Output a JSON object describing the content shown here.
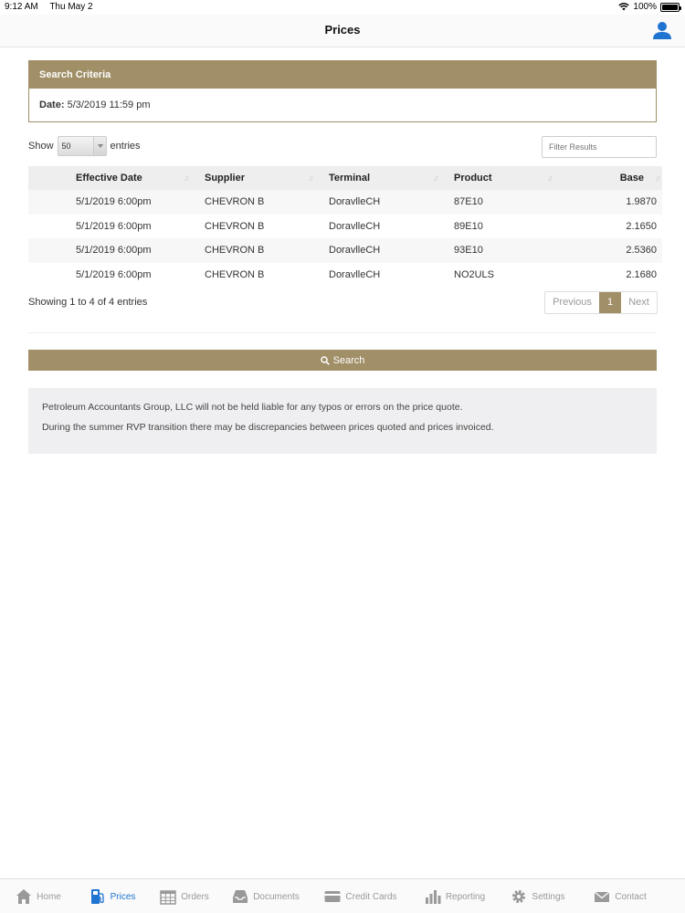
{
  "status": {
    "time": "9:12 AM",
    "date": "Thu May 2",
    "battery": "100%"
  },
  "nav": {
    "title": "Prices"
  },
  "criteria": {
    "header": "Search Criteria",
    "date_label": "Date:",
    "date_value": "5/3/2019 11:59 pm"
  },
  "controls": {
    "show_label": "Show",
    "entries_value": "50",
    "entries_label": "entries",
    "filter_placeholder": "Filter Results"
  },
  "table": {
    "headers": [
      "Effective Date",
      "Supplier",
      "Terminal",
      "Product",
      "Base"
    ],
    "rows": [
      [
        "5/1/2019 6:00pm",
        "CHEVRON B",
        "DoravlleCH",
        "87E10",
        "1.9870"
      ],
      [
        "5/1/2019 6:00pm",
        "CHEVRON B",
        "DoravlleCH",
        "89E10",
        "2.1650"
      ],
      [
        "5/1/2019 6:00pm",
        "CHEVRON B",
        "DoravlleCH",
        "93E10",
        "2.5360"
      ],
      [
        "5/1/2019 6:00pm",
        "CHEVRON B",
        "DoravlleCH",
        "NO2ULS",
        "2.1680"
      ]
    ]
  },
  "info": "Showing 1 to 4 of 4 entries",
  "pager": {
    "previous": "Previous",
    "page": "1",
    "next": "Next"
  },
  "search_button": "Search",
  "disclaimer": [
    "Petroleum Accountants Group, LLC will not be held liable for any typos or errors on the price quote.",
    "During the summer RVP transition there may be discrepancies between prices quoted and prices invoiced."
  ],
  "tabs": [
    {
      "label": "Home",
      "icon": "home-icon"
    },
    {
      "label": "Prices",
      "icon": "fuel-pump-icon"
    },
    {
      "label": "Orders",
      "icon": "calendar-icon"
    },
    {
      "label": "Documents",
      "icon": "inbox-icon"
    },
    {
      "label": "Credit Cards",
      "icon": "credit-card-icon"
    },
    {
      "label": "Reporting",
      "icon": "bar-chart-icon"
    },
    {
      "label": "Settings",
      "icon": "gear-icon"
    },
    {
      "label": "Contact",
      "icon": "envelope-icon"
    }
  ],
  "colors": {
    "accent": "#a08f67",
    "active_tab": "#1f73d1"
  }
}
